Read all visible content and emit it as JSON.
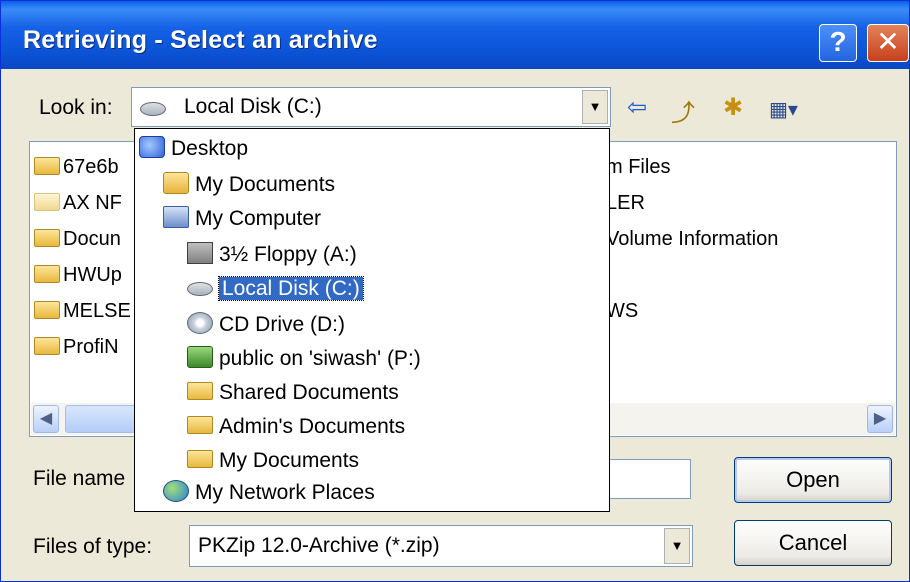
{
  "dialog": {
    "title": "Retrieving - Select an archive",
    "help_label": "?",
    "close_label": "✕"
  },
  "look_in": {
    "label": "Look in:",
    "value": "Local Disk (C:)"
  },
  "toolbar": {
    "back_icon": "⇦",
    "up_icon": "⤴",
    "new_folder_icon": "✱",
    "view_icon": "▦▾"
  },
  "files": [
    {
      "name": "67e6b",
      "light": false
    },
    {
      "name": "AX NF",
      "light": true
    },
    {
      "name": "Docun",
      "light": false
    },
    {
      "name": "HWUp",
      "light": false
    },
    {
      "name": "MELSE",
      "light": false
    },
    {
      "name": "ProfiN",
      "light": false
    }
  ],
  "files_right": [
    "m Files",
    "LER",
    "Volume Information",
    "",
    "WS"
  ],
  "dropdown_items": [
    {
      "label": "Desktop",
      "icon": "desktop-icon"
    },
    {
      "label": "My Documents",
      "icon": "my-documents-icon"
    },
    {
      "label": "My Computer",
      "icon": "my-computer-icon"
    },
    {
      "label": "3½ Floppy (A:)",
      "icon": "floppy-drive-icon"
    },
    {
      "label": "Local Disk (C:)",
      "icon": "hard-disk-icon"
    },
    {
      "label": "CD Drive (D:)",
      "icon": "cd-drive-icon"
    },
    {
      "label": "public on 'siwash' (P:)",
      "icon": "network-drive-icon"
    },
    {
      "label": "Shared Documents",
      "icon": "folder-icon"
    },
    {
      "label": "Admin's Documents",
      "icon": "folder-icon"
    },
    {
      "label": "My Documents",
      "icon": "folder-icon"
    },
    {
      "label": "My Network Places",
      "icon": "network-places-icon"
    }
  ],
  "file_name": {
    "label": "File name",
    "value": ""
  },
  "file_type": {
    "label": "Files of type:",
    "value": "PKZip 12.0-Archive (*.zip)"
  },
  "buttons": {
    "open": "Open",
    "cancel": "Cancel"
  }
}
